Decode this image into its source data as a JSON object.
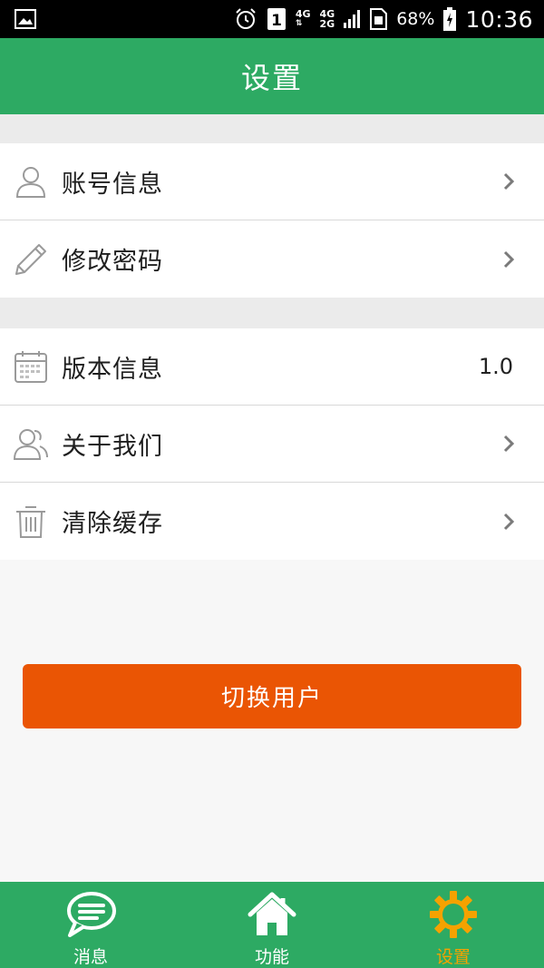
{
  "statusbar": {
    "network_top": "4G",
    "network_bottom": "2G",
    "sim_slot": "1",
    "battery_percent": "68%",
    "time": "10:36"
  },
  "appbar": {
    "title": "设置"
  },
  "groups": [
    {
      "items": [
        {
          "label": "账号信息",
          "icon": "user-icon",
          "trailing": "chevron"
        },
        {
          "label": "修改密码",
          "icon": "pencil-icon",
          "trailing": "chevron"
        }
      ]
    },
    {
      "items": [
        {
          "label": "版本信息",
          "icon": "calendar-icon",
          "trailing": "value",
          "value": "1.0"
        },
        {
          "label": "关于我们",
          "icon": "users-icon",
          "trailing": "chevron"
        },
        {
          "label": "清除缓存",
          "icon": "trash-icon",
          "trailing": "chevron"
        }
      ]
    }
  ],
  "switch_user": {
    "label": "切换用户"
  },
  "bottom_nav": {
    "items": [
      {
        "label": "消息",
        "icon": "message-icon",
        "active": false
      },
      {
        "label": "功能",
        "icon": "home-icon",
        "active": false
      },
      {
        "label": "设置",
        "icon": "gear-icon",
        "active": true
      }
    ]
  },
  "colors": {
    "primary_green": "#2daa63",
    "accent_orange": "#ea5504",
    "active_tab": "#f5a200"
  }
}
